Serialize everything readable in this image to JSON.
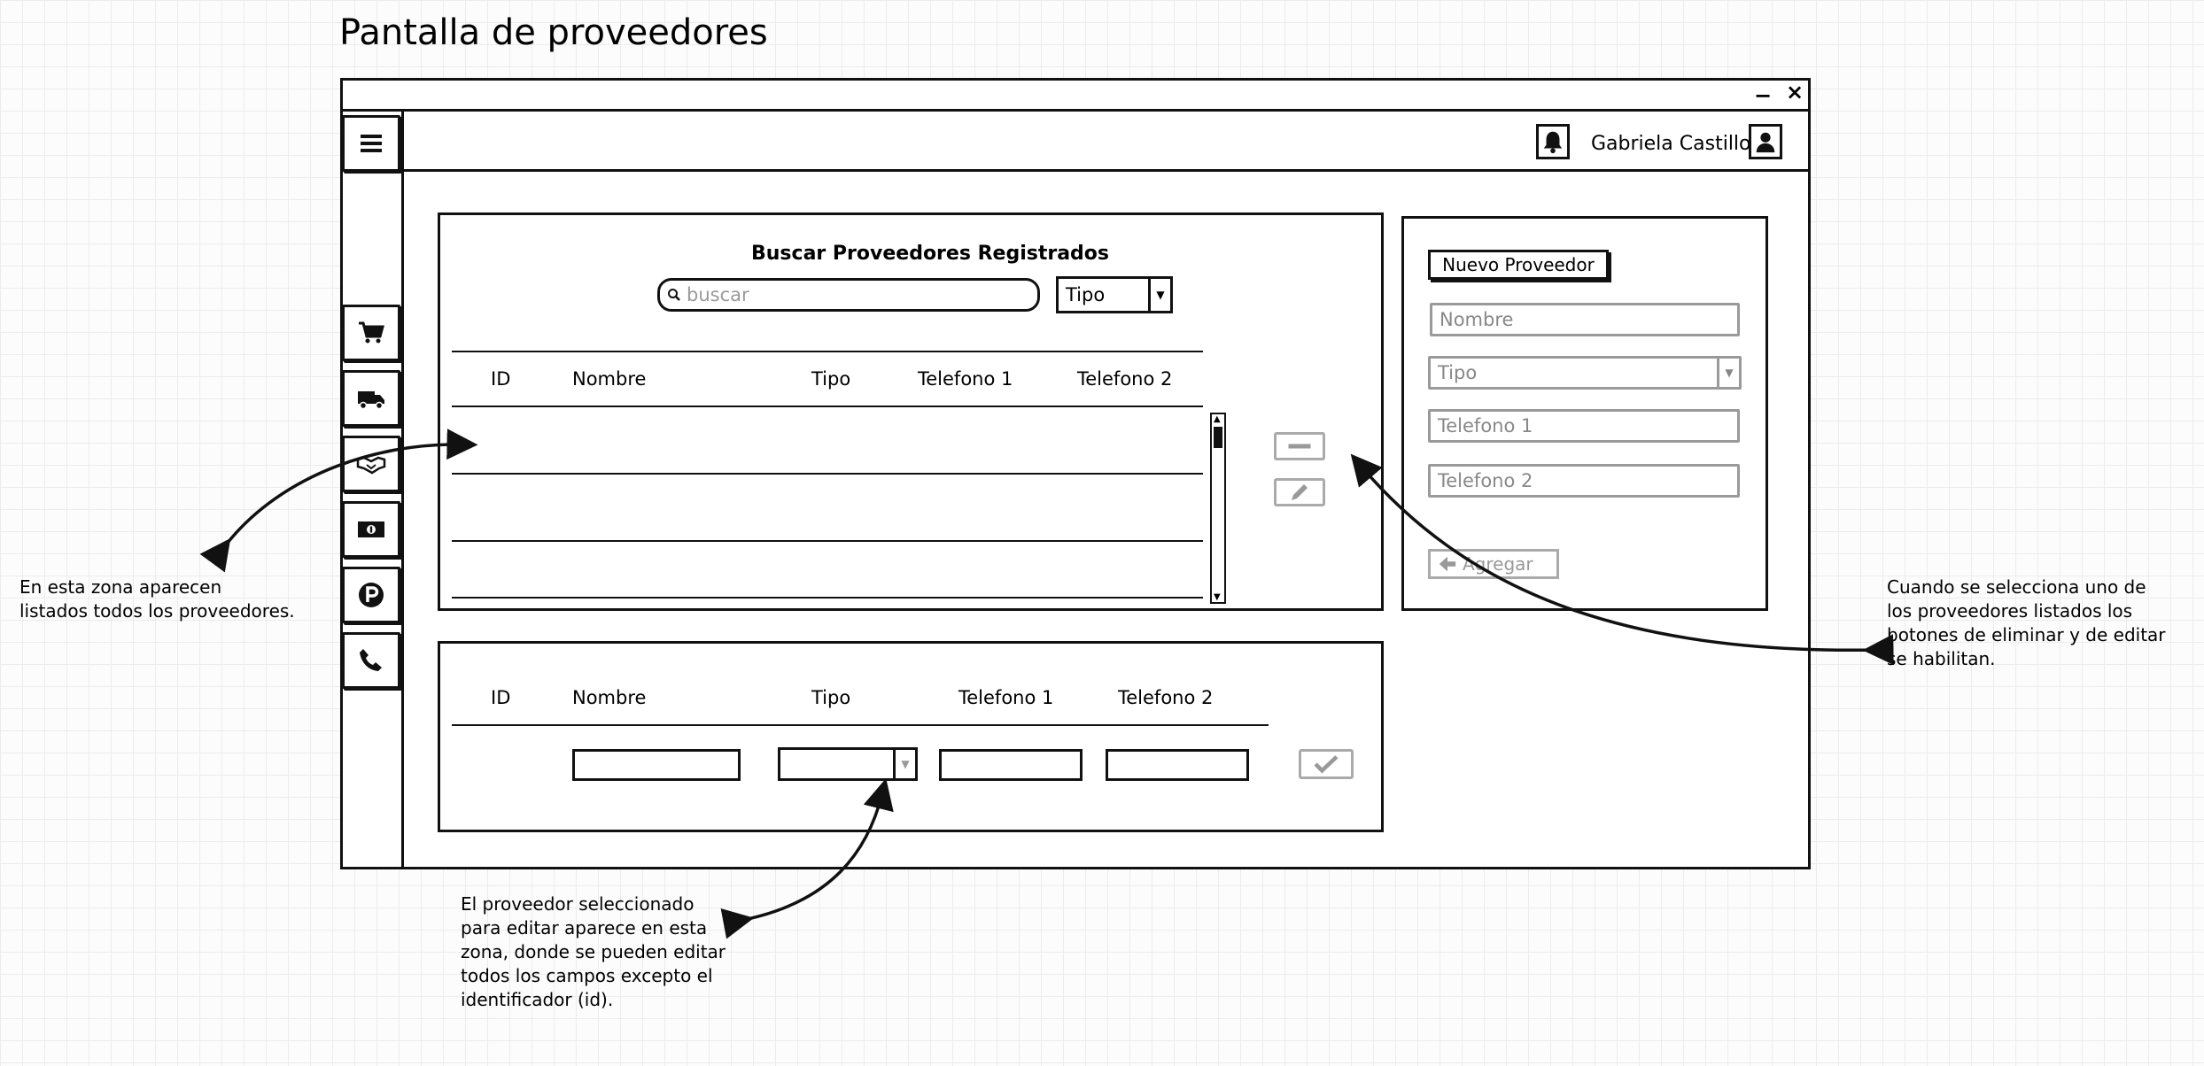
{
  "page_title": "Pantalla de proveedores",
  "window": {
    "minimize": "−",
    "close": "×"
  },
  "header": {
    "user_name": "Gabriela Castillo"
  },
  "search_panel": {
    "title": "Buscar Proveedores Registrados",
    "search_placeholder": "buscar",
    "type_filter": "Tipo",
    "columns": [
      "ID",
      "Nombre",
      "Tipo",
      "Telefono 1",
      "Telefono 2"
    ]
  },
  "edit_panel": {
    "columns": [
      "ID",
      "Nombre",
      "Tipo",
      "Telefono 1",
      "Telefono 2"
    ]
  },
  "new_provider": {
    "button": "Nuevo Proveedor",
    "name_placeholder": "Nombre",
    "type_placeholder": "Tipo",
    "phone1_placeholder": "Telefono 1",
    "phone2_placeholder": "Telefono 2",
    "add_button": "Agregar"
  },
  "sidebar": {
    "icons": [
      "hamburger-menu-icon",
      "shopping-cart-icon",
      "truck-icon",
      "handshake-icon",
      "money-bill-icon",
      "parking-icon",
      "phone-icon"
    ]
  },
  "annotations": {
    "left": "En esta zona aparecen\nlistados todos los proveedores.",
    "bottom": "El proveedor seleccionado\npara editar aparece en esta\nzona, donde se pueden editar\ntodos los campos excepto el\nidentificador (id).",
    "right": "Cuando se selecciona uno de\nlos proveedores listados los\nbotones de eliminar y de editar\nse habilitan."
  }
}
